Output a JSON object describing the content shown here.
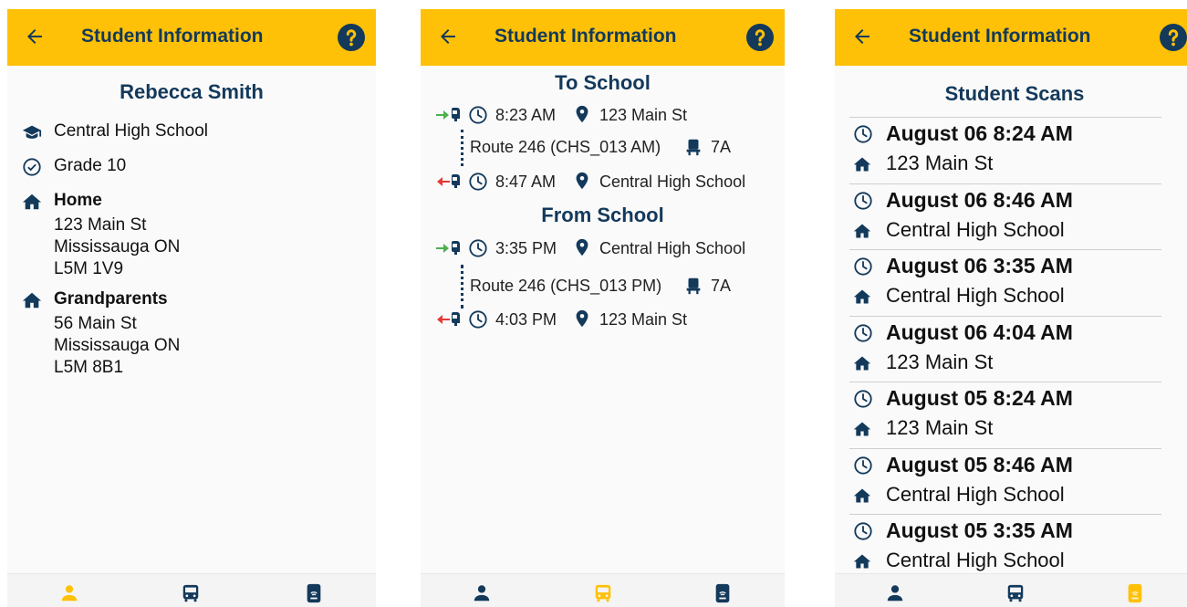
{
  "colors": {
    "appbar": "#ffc107",
    "navy": "#13395b",
    "board": "#4caf50",
    "exit": "#e53935",
    "nav_active": "#ffc107"
  },
  "screen1": {
    "title": "Student Information",
    "student_name": "Rebecca Smith",
    "school": "Central High School",
    "grade": "Grade 10",
    "addresses": [
      {
        "label": "Home",
        "street": "123 Main St",
        "city": "Mississauga ON",
        "postal": "L5M 1V9"
      },
      {
        "label": "Grandparents",
        "street": "56 Main St",
        "city": "Mississauga ON",
        "postal": "L5M 8B1"
      }
    ]
  },
  "screen2": {
    "title": "Student Information",
    "to_school": {
      "heading": "To School",
      "pickup_time": "8:23 AM",
      "pickup_place": "123 Main St",
      "route": "Route 246 (CHS_013 AM)",
      "seat": "7A",
      "dropoff_time": "8:47 AM",
      "dropoff_place": "Central High School"
    },
    "from_school": {
      "heading": "From School",
      "pickup_time": "3:35 PM",
      "pickup_place": "Central High School",
      "route": "Route 246 (CHS_013 PM)",
      "seat": "7A",
      "dropoff_time": "4:03 PM",
      "dropoff_place": "123 Main St"
    }
  },
  "screen3": {
    "title": "Student Scans",
    "header_title": "Student Information",
    "scans": [
      {
        "datetime": "August 06 8:24 AM",
        "place": "123 Main St"
      },
      {
        "datetime": "August 06 8:46 AM",
        "place": "Central High School"
      },
      {
        "datetime": "August 06 3:35 AM",
        "place": "Central High School"
      },
      {
        "datetime": "August 06 4:04 AM",
        "place": "123 Main St"
      },
      {
        "datetime": "August 05 8:24 AM",
        "place": "123 Main St"
      },
      {
        "datetime": "August 05 8:46 AM",
        "place": "Central High School"
      },
      {
        "datetime": "August 05 3:35 AM",
        "place": "Central High School"
      }
    ]
  },
  "icons": {
    "back": "back-arrow-icon",
    "help": "help-icon",
    "school": "graduation-cap-icon",
    "grade": "check-circle-icon",
    "home": "home-icon",
    "clock": "clock-icon",
    "pin": "location-pin-icon",
    "seat": "seat-icon",
    "person": "person-icon",
    "bus": "bus-icon",
    "scan": "scan-card-icon"
  }
}
